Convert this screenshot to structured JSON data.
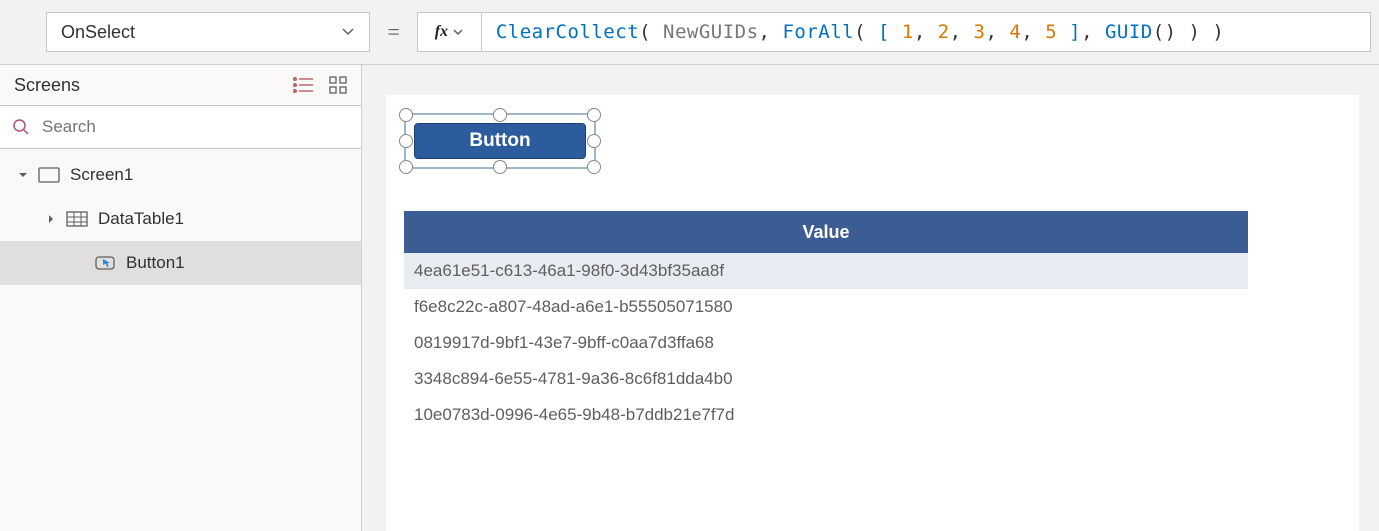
{
  "property_selected": "OnSelect",
  "formula_tokens": [
    {
      "t": "ClearCollect",
      "c": "tok-fn"
    },
    {
      "t": "( ",
      "c": "tok-op"
    },
    {
      "t": "NewGUIDs",
      "c": "tok-id"
    },
    {
      "t": ", ",
      "c": "tok-op"
    },
    {
      "t": "ForAll",
      "c": "tok-fn"
    },
    {
      "t": "( ",
      "c": "tok-op"
    },
    {
      "t": "[ ",
      "c": "tok-br"
    },
    {
      "t": "1",
      "c": "tok-num"
    },
    {
      "t": ", ",
      "c": "tok-op"
    },
    {
      "t": "2",
      "c": "tok-num"
    },
    {
      "t": ", ",
      "c": "tok-op"
    },
    {
      "t": "3",
      "c": "tok-num"
    },
    {
      "t": ", ",
      "c": "tok-op"
    },
    {
      "t": "4",
      "c": "tok-num"
    },
    {
      "t": ", ",
      "c": "tok-op"
    },
    {
      "t": "5",
      "c": "tok-num"
    },
    {
      "t": " ]",
      "c": "tok-br"
    },
    {
      "t": ", ",
      "c": "tok-op"
    },
    {
      "t": "GUID",
      "c": "tok-kw"
    },
    {
      "t": "() ) )",
      "c": "tok-op"
    }
  ],
  "tree": {
    "panel_title": "Screens",
    "search_placeholder": "Search",
    "items": [
      {
        "label": "Screen1",
        "level": 0,
        "icon": "screen",
        "expander": "down"
      },
      {
        "label": "DataTable1",
        "level": 1,
        "icon": "table",
        "expander": "right"
      },
      {
        "label": "Button1",
        "level": 2,
        "icon": "button",
        "expander": "none",
        "selected": true
      }
    ]
  },
  "canvas": {
    "button_text": "Button",
    "table": {
      "header": "Value",
      "rows": [
        "4ea61e51-c613-46a1-98f0-3d43bf35aa8f",
        "f6e8c22c-a807-48ad-a6e1-b55505071580",
        "0819917d-9bf1-43e7-9bff-c0aa7d3ffa68",
        "3348c894-6e55-4781-9a36-8c6f81dda4b0",
        "10e0783d-0996-4e65-9b48-b7ddb21e7f7d"
      ]
    }
  },
  "chart_data": {
    "type": "table",
    "title": "Value",
    "columns": [
      "Value"
    ],
    "rows": [
      [
        "4ea61e51-c613-46a1-98f0-3d43bf35aa8f"
      ],
      [
        "f6e8c22c-a807-48ad-a6e1-b55505071580"
      ],
      [
        "0819917d-9bf1-43e7-9bff-c0aa7d3ffa68"
      ],
      [
        "3348c894-6e55-4781-9a36-8c6f81dda4b0"
      ],
      [
        "10e0783d-0996-4e65-9b48-b7ddb21e7f7d"
      ]
    ]
  }
}
